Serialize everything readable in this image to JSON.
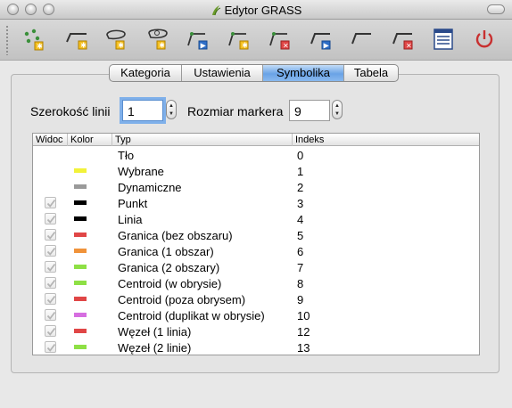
{
  "window": {
    "title": "Edytor GRASS"
  },
  "toolbar": {
    "tools": [
      {
        "name": "new-point-tool",
        "icon": "new-point-icon"
      },
      {
        "name": "new-line-tool",
        "icon": "new-line-icon"
      },
      {
        "name": "new-boundary-tool",
        "icon": "new-boundary-icon"
      },
      {
        "name": "new-centroid-tool",
        "icon": "new-centroid-icon"
      },
      {
        "name": "move-vertex-tool",
        "icon": "move-vertex-icon"
      },
      {
        "name": "add-vertex-tool",
        "icon": "add-vertex-icon"
      },
      {
        "name": "delete-vertex-tool",
        "icon": "delete-vertex-icon"
      },
      {
        "name": "move-line-tool",
        "icon": "move-line-icon"
      },
      {
        "name": "split-line-tool",
        "icon": "split-line-icon"
      },
      {
        "name": "delete-line-tool",
        "icon": "delete-line-icon"
      },
      {
        "name": "attributes-tool",
        "icon": "table-icon"
      },
      {
        "name": "close-editor-tool",
        "icon": "power-icon"
      }
    ]
  },
  "tabs": [
    {
      "label": "Kategoria",
      "active": false
    },
    {
      "label": "Ustawienia",
      "active": false
    },
    {
      "label": "Symbolika",
      "active": true
    },
    {
      "label": "Tabela",
      "active": false
    }
  ],
  "settings": {
    "line_width_label": "Szerokość linii",
    "line_width_value": "1",
    "marker_size_label": "Rozmiar markera",
    "marker_size_value": "9"
  },
  "table": {
    "columns": [
      "Widoc",
      "Kolor",
      "Typ",
      "Indeks"
    ],
    "rows": [
      {
        "visible": null,
        "color": null,
        "type": "Tło",
        "index": "0"
      },
      {
        "visible": null,
        "color": "#f2f23a",
        "type": "Wybrane",
        "index": "1"
      },
      {
        "visible": null,
        "color": "#9a9a9a",
        "type": "Dynamiczne",
        "index": "2"
      },
      {
        "visible": true,
        "color": "#000000",
        "type": "Punkt",
        "index": "3"
      },
      {
        "visible": true,
        "color": "#000000",
        "type": "Linia",
        "index": "4"
      },
      {
        "visible": true,
        "color": "#e04646",
        "type": "Granica (bez obszaru)",
        "index": "5"
      },
      {
        "visible": true,
        "color": "#f0933a",
        "type": "Granica (1 obszar)",
        "index": "6"
      },
      {
        "visible": true,
        "color": "#8ee045",
        "type": "Granica (2 obszary)",
        "index": "7"
      },
      {
        "visible": true,
        "color": "#8ee045",
        "type": "Centroid (w obrysie)",
        "index": "8"
      },
      {
        "visible": true,
        "color": "#e04646",
        "type": "Centroid (poza obrysem)",
        "index": "9"
      },
      {
        "visible": true,
        "color": "#d66ee0",
        "type": "Centroid (duplikat w obrysie)",
        "index": "10"
      },
      {
        "visible": true,
        "color": "#e04646",
        "type": "Węzeł (1 linia)",
        "index": "12"
      },
      {
        "visible": true,
        "color": "#8ee045",
        "type": "Węzeł (2 linie)",
        "index": "13"
      }
    ]
  }
}
